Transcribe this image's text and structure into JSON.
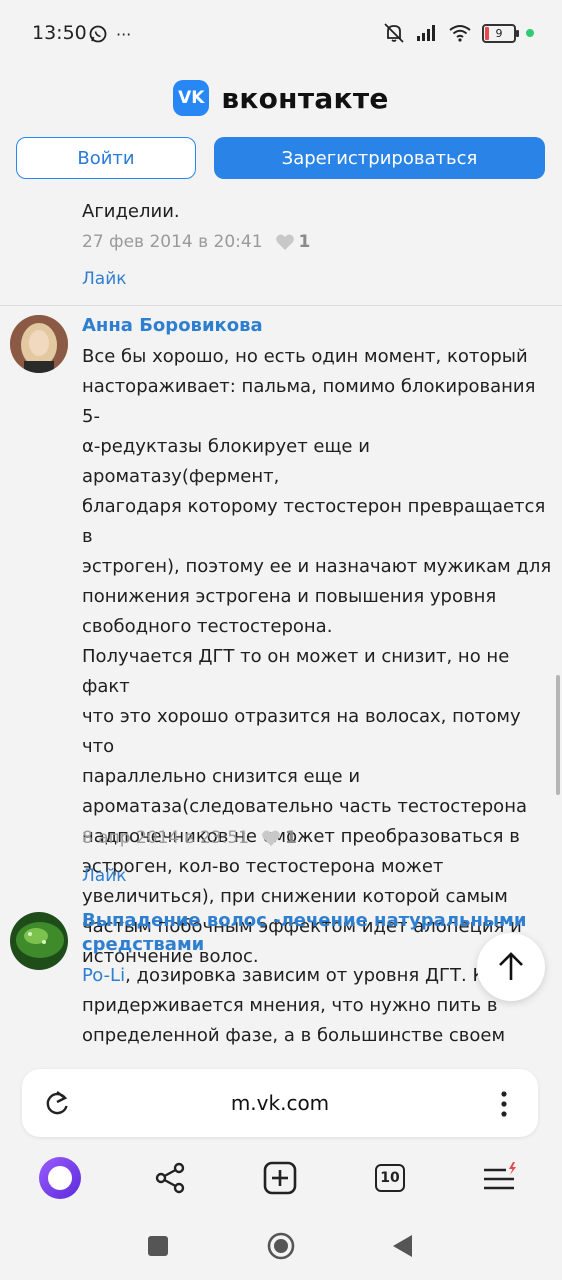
{
  "status": {
    "time": "13:50",
    "ellipsis": "···",
    "battery": "9"
  },
  "header": {
    "logo_text": "VK",
    "title": "вконтакте"
  },
  "auth": {
    "login_label": "Войти",
    "register_label": "Зарегистрироваться"
  },
  "comments": [
    {
      "text_tail": "Агиделии.",
      "date": "27 фев 2014 в 20:41",
      "likes": "1",
      "like_label": "Лайк"
    },
    {
      "author": "Анна Боровикова",
      "text_lines": [
        "Все бы хорошо, но есть один момент, который",
        "настораживает: пальма, помимо блокирования 5-",
        "α-редуктазы блокирует еще и ароматазу(фермент,",
        "благодаря которому тестостерон превращается в",
        "эстроген), поэтому ее и назначают мужикам для",
        "понижения эстрогена и повышения уровня",
        "свободного тестостерона.",
        "Получается ДГТ то он может и снизит, но не факт",
        "что это хорошо отразится на волосах, потому что",
        "параллельно снизится еще и",
        "ароматаза(следовательно часть тестостерона",
        "надпочечников не сможет преобразоваться в",
        "эстроген, кол-во тестостерона может",
        "увеличиться), при снижении которой самым",
        "частым побочным эффектом идет алопеция и",
        "истончение волос."
      ],
      "date": "8 апр 2014 в 23:51",
      "likes": "1",
      "like_label": "Лайк"
    },
    {
      "author_line1": "Выпадение волос -лечение натуральными",
      "author_line2": "средствами",
      "mention": "Po-Li",
      "text_first_rest": ", дозировка зависим от уровня ДГТ. К",
      "text_lines": [
        "придерживается мнения, что нужно пить в",
        "определенной фазе, а в большинстве своем"
      ]
    }
  ],
  "browser": {
    "url": "m.vk.com",
    "tabs_count": "10"
  },
  "colors": {
    "accent": "#2787f5",
    "link": "#2f7fd0",
    "alice": "#7b3ff2"
  }
}
